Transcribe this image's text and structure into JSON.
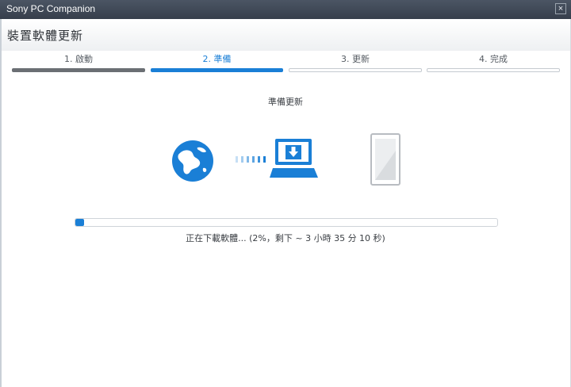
{
  "window": {
    "title": "Sony PC Companion",
    "close_glyph": "×"
  },
  "header": {
    "title": "裝置軟體更新"
  },
  "steps": [
    {
      "label": "1. 啟動",
      "state": "done"
    },
    {
      "label": "2. 準備",
      "state": "active"
    },
    {
      "label": "3. 更新",
      "state": "pending"
    },
    {
      "label": "4. 完成",
      "state": "pending"
    }
  ],
  "main": {
    "subtitle": "準備更新",
    "status_text": "正在下載軟體... (2%，剩下 ~ 3 小時 35 分 10 秒)",
    "progress_percent": 2,
    "icons": [
      "globe-icon",
      "transfer-dots-icon",
      "laptop-download-icon",
      "phone-icon"
    ]
  },
  "colors": {
    "accent": "#1a7fd6",
    "done": "#6b6f74",
    "titlebar": "#3f4856"
  }
}
